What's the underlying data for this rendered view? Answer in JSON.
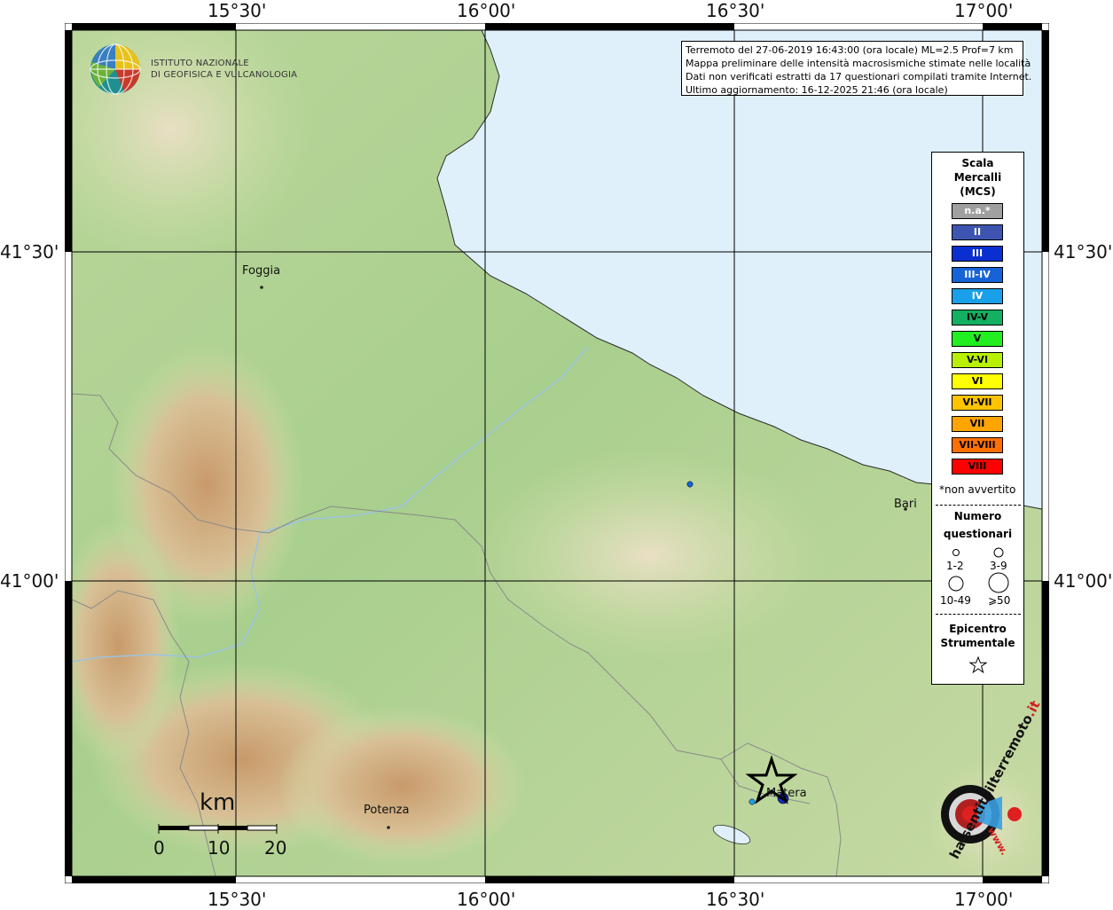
{
  "axes": {
    "top_lon": [
      "15°30'",
      "16°00'",
      "16°30'",
      "17°00'"
    ],
    "bottom_lon": [
      "15°30'",
      "16°00'",
      "16°30'",
      "17°00'"
    ],
    "left_lat": [
      "41°30'",
      "41°00'"
    ],
    "right_lat": [
      "41°30'",
      "41°00'"
    ]
  },
  "logo": {
    "line1": "ISTITUTO NAZIONALE",
    "line2": "DI GEOFISICA E VULCANOLOGIA"
  },
  "info": {
    "line1": "Terremoto del 27-06-2019 16:43:00 (ora locale) ML=2.5 Prof=7 km",
    "line2": "Mappa preliminare delle intensità macrosismiche stimate nelle località",
    "line3": "Dati non verificati estratti da 17 questionari compilati tramite Internet.",
    "line4": "Ultimo aggiornamento: 16-12-2025 21:46 (ora locale)"
  },
  "legend": {
    "title1": "Scala",
    "title2": "Mercalli",
    "title3": "(MCS)",
    "mcs": [
      {
        "label": "n.a.*",
        "color": "#a0a0a0",
        "text_color": "#ffffff"
      },
      {
        "label": "II",
        "color": "#3d55b0",
        "text_color": "#ffffff"
      },
      {
        "label": "III",
        "color": "#0a2fd0",
        "text_color": "#ffffff"
      },
      {
        "label": "III-IV",
        "color": "#1663d8",
        "text_color": "#ffffff"
      },
      {
        "label": "IV",
        "color": "#1aa0e8",
        "text_color": "#ffffff"
      },
      {
        "label": "IV-V",
        "color": "#12b060",
        "text_color": "#000000"
      },
      {
        "label": "V",
        "color": "#22ee22",
        "text_color": "#000000"
      },
      {
        "label": "V-VI",
        "color": "#b8f000",
        "text_color": "#000000"
      },
      {
        "label": "VI",
        "color": "#ffff00",
        "text_color": "#000000"
      },
      {
        "label": "VI-VII",
        "color": "#ffc400",
        "text_color": "#000000"
      },
      {
        "label": "VII",
        "color": "#ffa500",
        "text_color": "#000000"
      },
      {
        "label": "VII-VIII",
        "color": "#ff7000",
        "text_color": "#000000"
      },
      {
        "label": "VIII",
        "color": "#ff0000",
        "text_color": "#000000"
      }
    ],
    "not_felt_note": "*non avvertito",
    "questionnaires_title1": "Numero",
    "questionnaires_title2": "questionari",
    "sizes": [
      "1-2",
      "3-9",
      "10-49",
      "⩾50"
    ],
    "epicenter_title1": "Epicentro",
    "epicenter_title2": "Strumentale"
  },
  "cities": [
    "Foggia",
    "Bari",
    "Matera",
    "Potenza"
  ],
  "scale_bar": {
    "unit": "km",
    "labels": [
      "0",
      "10",
      "20"
    ]
  },
  "watermark": {
    "text1": "haisentitoilterremoto",
    "text2": ".it",
    "text3": "www."
  },
  "colors": {
    "sea": "#dff0fb",
    "land_light": "#cfe0a8",
    "land_green": "#9fca8a",
    "mountain": "#c8a071",
    "grid": "#000000",
    "border": "#8a8a8a",
    "river": "#9cc3e0"
  }
}
